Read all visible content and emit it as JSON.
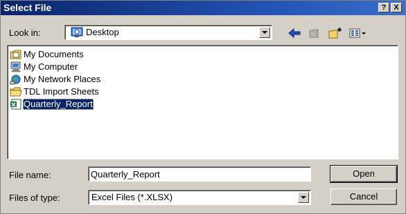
{
  "dialog": {
    "title": "Select File",
    "help_label": "?",
    "close_label": "X"
  },
  "lookin": {
    "label": "Look in:",
    "value": "Desktop",
    "icon": "desktop-icon"
  },
  "toolbar": {
    "icons": [
      "back-arrow-icon",
      "up-folder-icon",
      "new-folder-icon",
      "view-menu-icon"
    ]
  },
  "files": [
    {
      "name": "My Documents",
      "icon": "my-documents-icon"
    },
    {
      "name": "My Computer",
      "icon": "my-computer-icon"
    },
    {
      "name": "My Network Places",
      "icon": "network-places-icon"
    },
    {
      "name": "TDL Import Sheets",
      "icon": "folder-icon"
    },
    {
      "name": "Quarterly_Report",
      "icon": "excel-file-icon",
      "selected": true
    }
  ],
  "filename": {
    "label": "File name:",
    "value": "Quarterly_Report"
  },
  "filetype": {
    "label": "Files of type:",
    "value": "Excel Files (*.XLSX)"
  },
  "buttons": {
    "open": "Open",
    "cancel": "Cancel"
  },
  "colors": {
    "titlebar": "#0a246a",
    "dialog_face": "#d4d0c8",
    "selection": "#0a246a"
  }
}
